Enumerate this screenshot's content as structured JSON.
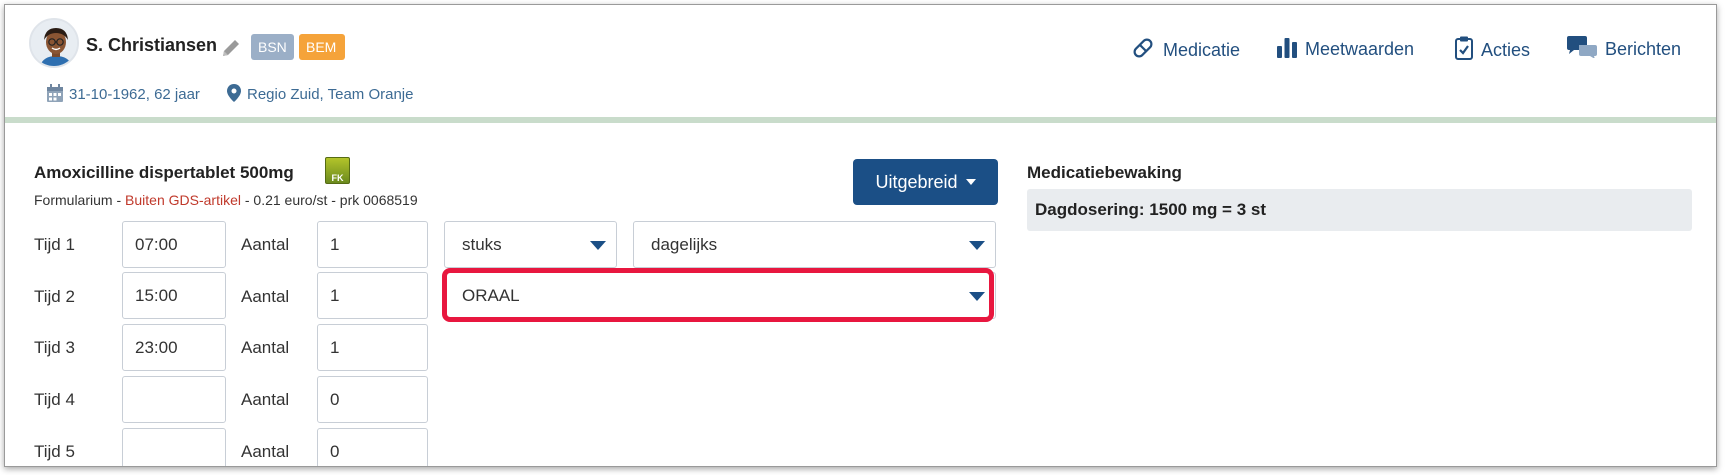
{
  "patient": {
    "name": "S. Christiansen",
    "badges": {
      "bsn": "BSN",
      "bem": "BEM"
    },
    "dob": "31-10-1962, 62 jaar",
    "region": "Regio Zuid, Team Oranje"
  },
  "nav": {
    "medicatie": "Medicatie",
    "meetwaarden": "Meetwaarden",
    "acties": "Acties",
    "berichten": "Berichten"
  },
  "medication": {
    "title": "Amoxicilline dispertablet 500mg",
    "fk_icon_label": "FK",
    "sub_formularium": "Formularium",
    "sub_sep": " - ",
    "sub_gds": "Buiten GDS-artikel",
    "sub_rest": " - 0.21 euro/st - prk 0068519"
  },
  "button_uitgebreid": "Uitgebreid",
  "schedule": [
    {
      "tijd_label": "Tijd 1",
      "tijd_value": "07:00",
      "aantal_label": "Aantal",
      "aantal_value": "1"
    },
    {
      "tijd_label": "Tijd 2",
      "tijd_value": "15:00",
      "aantal_label": "Aantal",
      "aantal_value": "1"
    },
    {
      "tijd_label": "Tijd 3",
      "tijd_value": "23:00",
      "aantal_label": "Aantal",
      "aantal_value": "1"
    },
    {
      "tijd_label": "Tijd 4",
      "tijd_value": "",
      "aantal_label": "Aantal",
      "aantal_value": "0"
    },
    {
      "tijd_label": "Tijd 5",
      "tijd_value": "",
      "aantal_label": "Aantal",
      "aantal_value": "0"
    }
  ],
  "selects": {
    "unit": "stuks",
    "frequency": "dagelijks",
    "route": "ORAAL"
  },
  "bewaking": {
    "title": "Medicatiebewaking",
    "summary": "Dagdosering: 1500 mg = 3 st"
  },
  "colors": {
    "brand_blue": "#1b4f86",
    "link_blue": "#224f7f",
    "highlight_red": "#e8173f",
    "badge_bsn": "#9bafc7",
    "badge_bem": "#f5a33a",
    "gds_red": "#c0392b"
  }
}
